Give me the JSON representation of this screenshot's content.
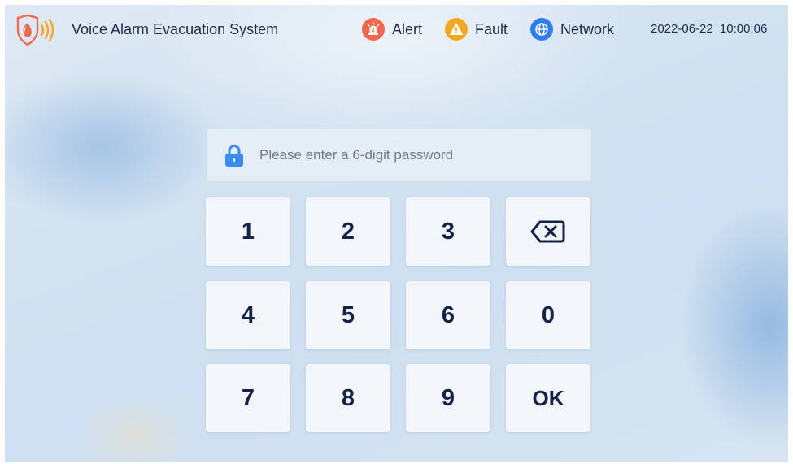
{
  "header": {
    "app_title": "Voice Alarm Evacuation System",
    "logo_icon": "fire-sound-shield-logo",
    "status_items": [
      {
        "label": "Alert",
        "icon": "alarm-siren-icon",
        "color": "#f2664b"
      },
      {
        "label": "Fault",
        "icon": "warning-icon",
        "color": "#f5a623"
      },
      {
        "label": "Network",
        "icon": "globe-icon",
        "color": "#2f7df0"
      }
    ],
    "datetime": "2022-06-22 10:00:06"
  },
  "password": {
    "value": "",
    "placeholder": "Please enter a 6-digit password",
    "icon": "lock-icon",
    "icon_color": "#3a8cf0"
  },
  "keypad": {
    "keys": [
      {
        "label": "1"
      },
      {
        "label": "2"
      },
      {
        "label": "3"
      },
      {
        "label": "",
        "icon": "backspace-icon"
      },
      {
        "label": "4"
      },
      {
        "label": "5"
      },
      {
        "label": "6"
      },
      {
        "label": "0"
      },
      {
        "label": "7"
      },
      {
        "label": "8"
      },
      {
        "label": "9"
      },
      {
        "label": "OK"
      }
    ]
  }
}
